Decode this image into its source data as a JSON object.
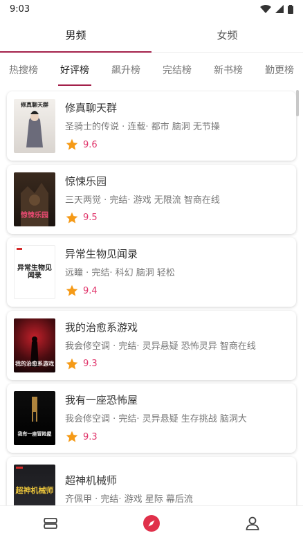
{
  "status": {
    "time": "9:03"
  },
  "gender_tabs": [
    {
      "label": "男频",
      "active": true
    },
    {
      "label": "女频",
      "active": false
    }
  ],
  "rank_tabs": [
    {
      "label": "热搜榜",
      "active": false
    },
    {
      "label": "好评榜",
      "active": true
    },
    {
      "label": "飙升榜",
      "active": false
    },
    {
      "label": "完结榜",
      "active": false
    },
    {
      "label": "新书榜",
      "active": false
    },
    {
      "label": "勤更榜",
      "active": false
    }
  ],
  "books": [
    {
      "title": "修真聊天群",
      "meta": "圣骑士的传说 · 连载· 都市 脑洞 无节操",
      "score": "9.6",
      "cover_text": "修真聊天群",
      "cover_style": "light"
    },
    {
      "title": "惊悚乐园",
      "meta": "三天两觉 · 完结· 游戏 无限流 智商在线",
      "score": "9.5",
      "cover_text": "惊悚乐园",
      "cover_style": "dark"
    },
    {
      "title": "异常生物见闻录",
      "meta": "远瞳 · 完结· 科幻 脑洞 轻松",
      "score": "9.4",
      "cover_text": "异常生物见闻录",
      "cover_style": "white"
    },
    {
      "title": "我的治愈系游戏",
      "meta": "我会修空调 · 完结· 灵异悬疑 恐怖灵异 智商在线",
      "score": "9.3",
      "cover_text": "我的治愈系游戏",
      "cover_style": "red"
    },
    {
      "title": "我有一座恐怖屋",
      "meta": "我会修空调 · 完结· 灵异悬疑 生存挑战 脑洞大",
      "score": "9.3",
      "cover_text": "我有一座冒险屋",
      "cover_style": "black"
    },
    {
      "title": "超神机械师",
      "meta": "齐佩甲 · 完结· 游戏 星际 幕后流",
      "score": "",
      "cover_text": "超神机械师",
      "cover_style": "mech"
    }
  ],
  "icons": {
    "star": "star-icon",
    "nav": [
      "bookshelf-icon",
      "discover-compass-icon",
      "profile-icon"
    ]
  },
  "colors": {
    "accent": "#a3204a",
    "score": "#e0356b",
    "star": "#f59a17"
  }
}
